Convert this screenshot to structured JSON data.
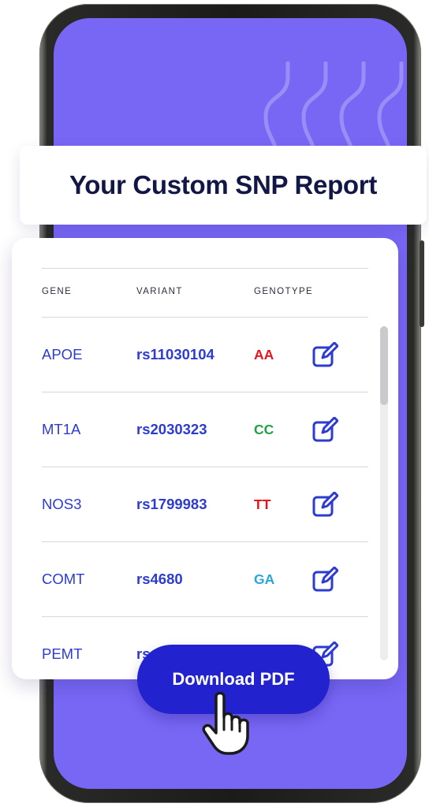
{
  "report": {
    "title": "Your Custom SNP Report"
  },
  "table": {
    "headers": {
      "gene": "GENE",
      "variant": "VARIANT",
      "genotype": "GENOTYPE"
    },
    "rows": [
      {
        "gene": "APOE",
        "variant": "rs11030104",
        "genotype": "AA",
        "genotype_color": "#e8151b"
      },
      {
        "gene": "MT1A",
        "variant": "rs2030323",
        "genotype": "CC",
        "genotype_color": "#20a14a"
      },
      {
        "gene": "NOS3",
        "variant": "rs1799983",
        "genotype": "TT",
        "genotype_color": "#e8151b"
      },
      {
        "gene": "COMT",
        "variant": "rs4680",
        "genotype": "GA",
        "genotype_color": "#2aa6dc"
      },
      {
        "gene": "PEMT",
        "variant": "rs",
        "genotype": "",
        "genotype_color": "#2d3bd0"
      }
    ]
  },
  "actions": {
    "download_label": "Download PDF"
  },
  "icons": {
    "edit": "edit-icon",
    "pointer": "hand-pointer-icon"
  },
  "colors": {
    "screen": "#7867f5",
    "accent": "#2d3bd0",
    "button": "#2222cf",
    "title": "#121746"
  }
}
